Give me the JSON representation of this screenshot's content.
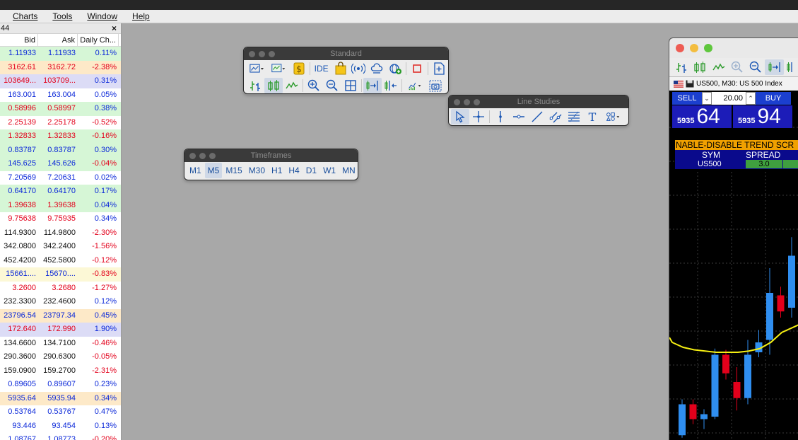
{
  "menu": {
    "items": [
      "Charts",
      "Tools",
      "Window",
      "Help"
    ]
  },
  "colors": {
    "up": "#0b28d9",
    "down": "#e3001b",
    "neutral": "#111111"
  },
  "market_watch": {
    "title": "44",
    "close": "×",
    "headers": {
      "bid": "Bid",
      "ask": "Ask",
      "change": "Daily Ch..."
    },
    "rows": [
      {
        "bid": "1.11933",
        "ask": "1.11933",
        "change": "0.11%",
        "color": "up",
        "bg": "#d6f6d6"
      },
      {
        "bid": "3162.61",
        "ask": "3162.72",
        "change": "-2.38%",
        "color": "down",
        "bg": "#fde9c8"
      },
      {
        "bid": "103649...",
        "ask": "103709...",
        "change": "0.31%",
        "color": "down",
        "bg": "#dcdcf6"
      },
      {
        "bid": "163.001",
        "ask": "163.004",
        "change": "0.05%",
        "color": "up",
        "bg": "#ffffff"
      },
      {
        "bid": "0.58996",
        "ask": "0.58997",
        "change": "0.38%",
        "color": "down",
        "bg": "#d6f6d6"
      },
      {
        "bid": "2.25139",
        "ask": "2.25178",
        "change": "-0.52%",
        "color": "down",
        "bg": "#ffffff"
      },
      {
        "bid": "1.32833",
        "ask": "1.32833",
        "change": "-0.16%",
        "color": "down",
        "bg": "#d6f6d6"
      },
      {
        "bid": "0.83787",
        "ask": "0.83787",
        "change": "0.30%",
        "color": "up",
        "bg": "#d6f6d6"
      },
      {
        "bid": "145.625",
        "ask": "145.626",
        "change": "-0.04%",
        "color": "up",
        "bg": "#d6f6d6"
      },
      {
        "bid": "7.20569",
        "ask": "7.20631",
        "change": "0.02%",
        "color": "up",
        "bg": "#ffffff"
      },
      {
        "bid": "0.64170",
        "ask": "0.64170",
        "change": "0.17%",
        "color": "up",
        "bg": "#d6f6d6"
      },
      {
        "bid": "1.39638",
        "ask": "1.39638",
        "change": "0.04%",
        "color": "down",
        "bg": "#d6f6d6"
      },
      {
        "bid": "9.75638",
        "ask": "9.75935",
        "change": "0.34%",
        "color": "down",
        "bg": "#ffffff"
      },
      {
        "bid": "114.9300",
        "ask": "114.9800",
        "change": "-2.30%",
        "color": "neutral",
        "bg": "#ffffff"
      },
      {
        "bid": "342.0800",
        "ask": "342.2400",
        "change": "-1.56%",
        "color": "neutral",
        "bg": "#ffffff"
      },
      {
        "bid": "452.4200",
        "ask": "452.5800",
        "change": "-0.12%",
        "color": "neutral",
        "bg": "#ffffff"
      },
      {
        "bid": "15661....",
        "ask": "15670....",
        "change": "-0.83%",
        "color": "up",
        "bg": "#fcf8d6"
      },
      {
        "bid": "3.2600",
        "ask": "3.2680",
        "change": "-1.27%",
        "color": "down",
        "bg": "#ffffff"
      },
      {
        "bid": "232.3300",
        "ask": "232.4600",
        "change": "0.12%",
        "color": "neutral",
        "bg": "#ffffff"
      },
      {
        "bid": "23796.54",
        "ask": "23797.34",
        "change": "0.45%",
        "color": "up",
        "bg": "#fde9c8"
      },
      {
        "bid": "172.640",
        "ask": "172.990",
        "change": "1.90%",
        "color": "down",
        "bg": "#dcdcf6"
      },
      {
        "bid": "134.6600",
        "ask": "134.7100",
        "change": "-0.46%",
        "color": "neutral",
        "bg": "#ffffff"
      },
      {
        "bid": "290.3600",
        "ask": "290.6300",
        "change": "-0.05%",
        "color": "neutral",
        "bg": "#ffffff"
      },
      {
        "bid": "159.0900",
        "ask": "159.2700",
        "change": "-2.31%",
        "color": "neutral",
        "bg": "#ffffff"
      },
      {
        "bid": "0.89605",
        "ask": "0.89607",
        "change": "0.23%",
        "color": "up",
        "bg": "#ffffff"
      },
      {
        "bid": "5935.64",
        "ask": "5935.94",
        "change": "0.34%",
        "color": "up",
        "bg": "#fde9c8"
      },
      {
        "bid": "0.53764",
        "ask": "0.53767",
        "change": "0.47%",
        "color": "up",
        "bg": "#ffffff"
      },
      {
        "bid": "93.446",
        "ask": "93.454",
        "change": "0.13%",
        "color": "up",
        "bg": "#ffffff"
      },
      {
        "bid": "1.08767",
        "ask": "1.08773",
        "change": "-0.20%",
        "color": "up",
        "bg": "#ffffff"
      }
    ]
  },
  "toolbars": {
    "standard": {
      "title": "Standard",
      "ide_label": "IDE"
    },
    "line_studies": {
      "title": "Line Studies",
      "text_label": "T"
    },
    "timeframes": {
      "title": "Timeframes",
      "items": [
        "M1",
        "M5",
        "M15",
        "M30",
        "H1",
        "H4",
        "D1",
        "W1",
        "MN"
      ],
      "selected": "M5"
    }
  },
  "chart": {
    "tab_title": "US500, M30:  US 500 Index",
    "sell_label": "SELL",
    "buy_label": "BUY",
    "volume": "20.00",
    "sell_small": "5935",
    "sell_big": "64",
    "buy_small": "5935",
    "buy_big": "94",
    "banner": "NABLE-DISABLE TREND SCR",
    "sym_label": "SYM",
    "spread_label": "SPREAD",
    "symbol": "US500",
    "spread": "3.0",
    "candles": [
      {
        "o": 5,
        "c": 30,
        "h": 34,
        "l": 3,
        "up": true
      },
      {
        "o": 30,
        "c": 18,
        "h": 34,
        "l": 14,
        "up": false
      },
      {
        "o": 18,
        "c": 22,
        "h": 26,
        "l": 10,
        "up": true
      },
      {
        "o": 20,
        "c": 70,
        "h": 75,
        "l": 18,
        "up": true
      },
      {
        "o": 70,
        "c": 55,
        "h": 74,
        "l": 50,
        "up": false
      },
      {
        "o": 48,
        "c": 35,
        "h": 60,
        "l": 25,
        "up": false
      },
      {
        "o": 35,
        "c": 70,
        "h": 82,
        "l": 30,
        "up": true
      },
      {
        "o": 72,
        "c": 80,
        "h": 90,
        "l": 68,
        "up": true
      },
      {
        "o": 82,
        "c": 120,
        "h": 140,
        "l": 70,
        "up": true
      },
      {
        "o": 118,
        "c": 105,
        "h": 125,
        "l": 100,
        "up": false
      },
      {
        "o": 108,
        "c": 150,
        "h": 165,
        "l": 100,
        "up": true
      }
    ],
    "ma": [
      80,
      76,
      74,
      73,
      72,
      72,
      72,
      73,
      75,
      80,
      88
    ],
    "ma_color": "#f5ef12"
  }
}
